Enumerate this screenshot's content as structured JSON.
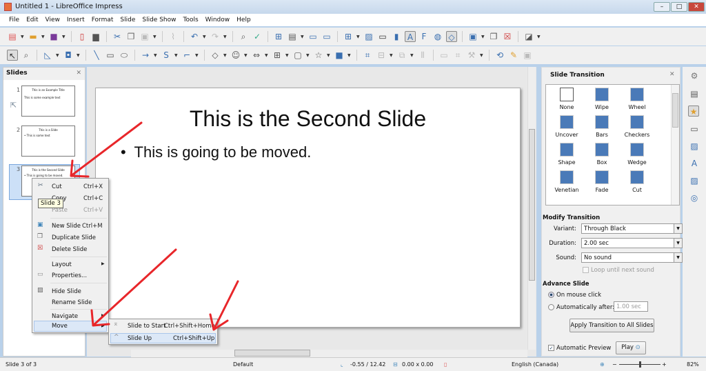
{
  "window": {
    "title": "Untitled 1 - LibreOffice Impress",
    "min": "–",
    "max": "□",
    "close": "✕"
  },
  "menu": [
    "File",
    "Edit",
    "View",
    "Insert",
    "Format",
    "Slide",
    "Slide Show",
    "Tools",
    "Window",
    "Help"
  ],
  "slides_panel": {
    "title": "Slides",
    "close": "✕",
    "thumbs": [
      {
        "num": "1",
        "title": "This is an Example Title",
        "body": "This is some example text"
      },
      {
        "num": "2",
        "title": "This is a Slide",
        "body": "• This is some text"
      },
      {
        "num": "3",
        "title": "This is the Second Slide",
        "body": "• This is going to be moved."
      }
    ]
  },
  "slide": {
    "title": "This is the Second Slide",
    "bullet": "This is going to be moved."
  },
  "tooltip": "Slide 3",
  "context_menu": [
    {
      "label": "Cut",
      "shortcut": "Ctrl+X"
    },
    {
      "label": "Copy",
      "shortcut": "Ctrl+C"
    },
    {
      "label": "Paste",
      "shortcut": "Ctrl+V",
      "disabled": true
    },
    {
      "label": "New Slide",
      "shortcut": "Ctrl+M"
    },
    {
      "label": "Duplicate Slide"
    },
    {
      "label": "Delete Slide"
    },
    {
      "label": "Layout",
      "submenu": true
    },
    {
      "label": "Properties..."
    },
    {
      "label": "Hide Slide"
    },
    {
      "label": "Rename Slide"
    },
    {
      "label": "Navigate",
      "submenu": true
    },
    {
      "label": "Move",
      "submenu": true
    }
  ],
  "move_submenu": [
    {
      "label": "Slide to Start",
      "shortcut": "Ctrl+Shift+Home"
    },
    {
      "label": "Slide Up",
      "shortcut": "Ctrl+Shift+Up"
    }
  ],
  "deck": {
    "title": "Slide Transition",
    "close": "✕",
    "transitions": [
      "None",
      "Wipe",
      "Wheel",
      "Uncover",
      "Bars",
      "Checkers",
      "Shape",
      "Box",
      "Wedge",
      "Venetian",
      "Fade",
      "Cut"
    ],
    "modify_title": "Modify Transition",
    "variant_label": "Variant:",
    "variant": "Through Black",
    "duration_label": "Duration:",
    "duration": "2.00 sec",
    "sound_label": "Sound:",
    "sound": "No sound",
    "loop_label": "Loop until next sound",
    "advance_title": "Advance Slide",
    "on_click": "On mouse click",
    "auto_after": "Automatically after:",
    "auto_value": "1.00 sec",
    "apply_all": "Apply Transition to All Slides",
    "auto_preview": "Automatic Preview",
    "play": "Play"
  },
  "status": {
    "slide": "Slide 3 of 3",
    "master": "Default",
    "position": "-0.55 / 12.42",
    "size": "0.00 x 0.00",
    "language": "English (Canada)",
    "zoom": "82%"
  },
  "colors": {
    "annotation": "#e8262a",
    "selection": "#cce0f7"
  }
}
